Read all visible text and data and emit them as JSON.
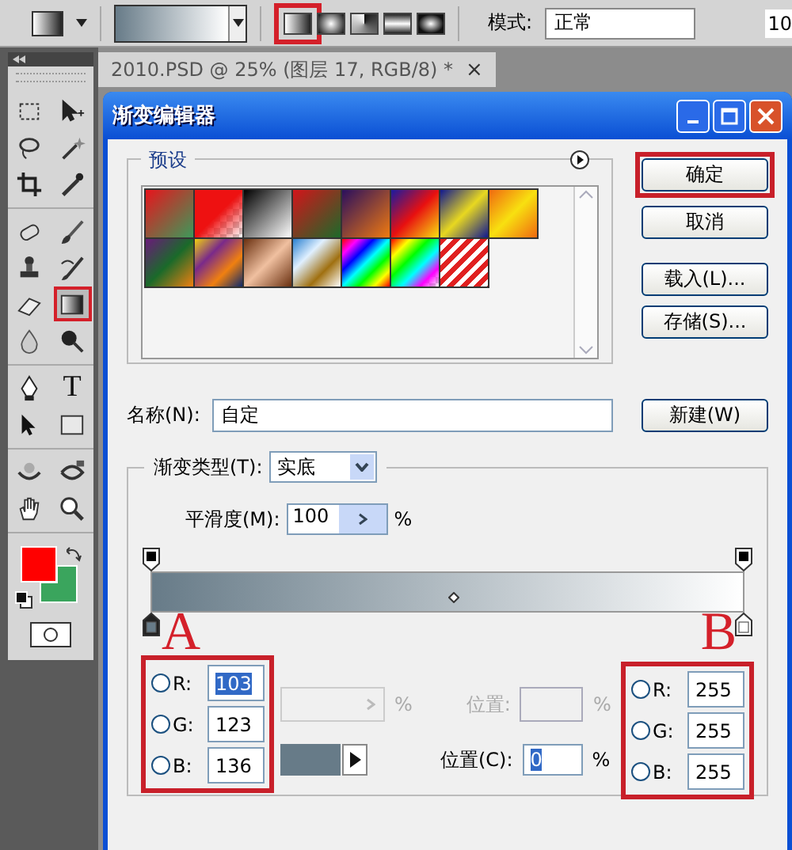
{
  "options_bar": {
    "gradient_types": [
      {
        "kind": "linear",
        "selected": true
      },
      {
        "kind": "radial",
        "selected": false
      },
      {
        "kind": "angle",
        "selected": false
      },
      {
        "kind": "reflected",
        "selected": false
      },
      {
        "kind": "diamond",
        "selected": false
      }
    ],
    "mode_label": "模式:",
    "mode_value": "正常",
    "opacity_fragment": "10"
  },
  "toolbox": {
    "groups": [
      {
        "tools": [
          {
            "kind": "marquee",
            "selected": false
          },
          {
            "kind": "move",
            "selected": false
          },
          {
            "kind": "lasso",
            "selected": false
          },
          {
            "kind": "wand",
            "selected": false
          },
          {
            "kind": "crop",
            "selected": false
          },
          {
            "kind": "eyedropper",
            "selected": false
          }
        ]
      },
      {
        "tools": [
          {
            "kind": "heal",
            "selected": false
          },
          {
            "kind": "brush",
            "selected": false
          },
          {
            "kind": "stamp",
            "selected": false
          },
          {
            "kind": "history",
            "selected": false
          },
          {
            "kind": "eraser",
            "selected": false
          },
          {
            "kind": "gradient",
            "selected": true
          },
          {
            "kind": "blur",
            "selected": false
          },
          {
            "kind": "dodge",
            "selected": false
          }
        ]
      },
      {
        "tools": [
          {
            "kind": "pen",
            "selected": false
          },
          {
            "kind": "type",
            "glyph": "T",
            "selected": false
          },
          {
            "kind": "path",
            "selected": false
          },
          {
            "kind": "shape",
            "selected": false
          }
        ]
      },
      {
        "tools": [
          {
            "kind": "rotate3d",
            "selected": false
          },
          {
            "kind": "orbit3d",
            "selected": false
          },
          {
            "kind": "hand",
            "selected": false
          },
          {
            "kind": "zoom",
            "selected": false
          }
        ]
      }
    ],
    "swatches": [
      {
        "kind": "foreground",
        "color": "#ff0000"
      },
      {
        "kind": "background",
        "color": "#3aa55d"
      }
    ]
  },
  "document_tab": {
    "title": "2010.PSD @ 25% (图层 17, RGB/8) *",
    "close": "×"
  },
  "dialog": {
    "title": "渐变编辑器",
    "presets_label": "预设",
    "presets": [
      {
        "kind": "linear"
      },
      {
        "kind": "checker"
      },
      {
        "kind": "linear"
      },
      {
        "kind": "linear"
      },
      {
        "kind": "linear"
      },
      {
        "kind": "linear"
      },
      {
        "kind": "linear"
      },
      {
        "kind": "linear"
      },
      {
        "kind": "linear"
      },
      {
        "kind": "linear"
      },
      {
        "kind": "linear"
      },
      {
        "kind": "linear"
      },
      {
        "kind": "linear"
      },
      {
        "kind": "checker"
      },
      {
        "kind": "stripes"
      }
    ],
    "buttons": [
      {
        "label": "确定",
        "highlighted": true
      },
      {
        "label": "取消",
        "highlighted": false
      },
      {
        "label": "载入(L)...",
        "highlighted": false
      },
      {
        "label": "存储(S)...",
        "highlighted": false
      }
    ],
    "name_label": "名称(N):",
    "name_value": "自定",
    "new_button": "新建(W)",
    "type_label": "渐变类型(T):",
    "type_value": "实底",
    "smoothness_label": "平滑度(M):",
    "smoothness_value": "100",
    "smoothness_unit": "%",
    "opacity_stops": [
      {
        "color": "#000000"
      },
      {
        "color": "#000000"
      }
    ],
    "color_stops": [
      {
        "color": "#677b88",
        "selected": true
      },
      {
        "color": "#ffffff",
        "selected": false
      }
    ],
    "annotations": [
      "A",
      "B"
    ],
    "left_channels": {
      "highlighted": true,
      "items": [
        {
          "label": "R:",
          "value": "103",
          "checked": false,
          "selected": true
        },
        {
          "label": "G:",
          "value": "123",
          "checked": false,
          "selected": false
        },
        {
          "label": "B:",
          "value": "136",
          "checked": false,
          "selected": false
        }
      ]
    },
    "opacity_unit": "%",
    "opacity_location_label": "位置:",
    "opacity_location_unit": "%",
    "stop_swatch": {
      "color": "#677b88"
    },
    "location_label": "位置(C):",
    "location_value": "0",
    "location_unit": "%",
    "right_channels": {
      "highlighted": true,
      "items": [
        {
          "label": "R:",
          "value": "255",
          "checked": false,
          "selected": false
        },
        {
          "label": "G:",
          "value": "255",
          "checked": false,
          "selected": false
        },
        {
          "label": "B:",
          "value": "255",
          "checked": false,
          "selected": false
        }
      ]
    }
  }
}
